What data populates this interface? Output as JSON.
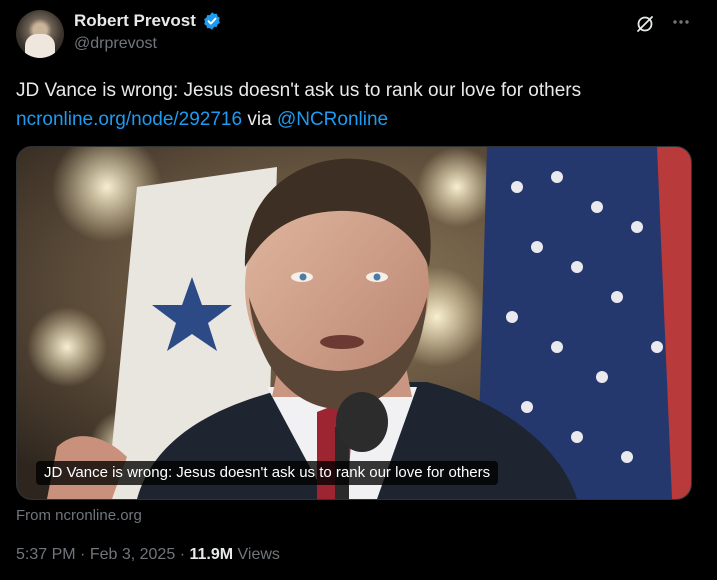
{
  "author": {
    "name": "Robert Prevost",
    "handle": "@drprevost",
    "verified_color": "#1d9bf0"
  },
  "icons": {
    "grok": "grok-icon",
    "more": "more-icon",
    "verified": "verified-badge-icon"
  },
  "tweet": {
    "text": "JD Vance is wrong: Jesus doesn't ask us to rank our love for others",
    "link_text": "ncronline.org/node/292716",
    "via_text": "via",
    "mention": "@NCRonline"
  },
  "card": {
    "caption": "JD Vance is wrong: Jesus doesn't ask us to rank our love for others",
    "source": "From ncronline.org"
  },
  "meta": {
    "time": "5:37 PM",
    "separator": "·",
    "date": "Feb 3, 2025",
    "views_count": "11.9M",
    "views_label": "Views"
  },
  "colors": {
    "background": "#000000",
    "text": "#e7e9ea",
    "secondary": "#71767b",
    "link": "#1d9bf0"
  }
}
